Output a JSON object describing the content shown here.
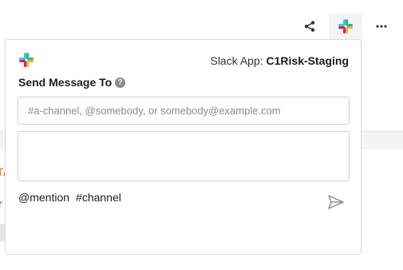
{
  "toolbar": {
    "share_icon": "share-icon",
    "slack_icon": "slack-icon",
    "more_icon": "more-horizontal-icon"
  },
  "popover": {
    "app_prefix": "Slack App:",
    "app_name": "C1Risk-Staging",
    "send_title": "Send Message To",
    "help_glyph": "?",
    "recipient_placeholder": "#a-channel, @somebody, or somebody@example.com",
    "recipient_value": "",
    "message_value": "",
    "hint_mention": "@mention",
    "hint_channel": "#channel",
    "send_icon": "send-icon"
  },
  "colors": {
    "slack_blue": "#36C5F0",
    "slack_green": "#2EB67D",
    "slack_yellow": "#ECB22E",
    "slack_red": "#E01E5A",
    "icon_gray": "#333333",
    "send_gray": "#8a8a8a"
  }
}
